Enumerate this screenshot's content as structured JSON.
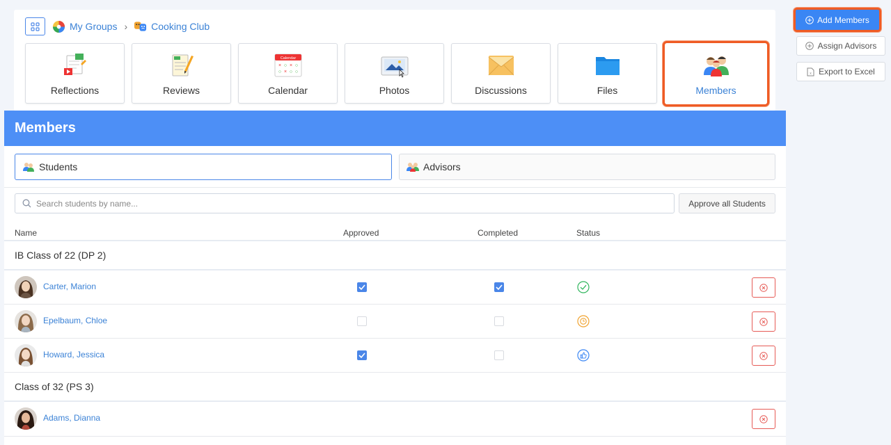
{
  "breadcrumb": {
    "root": "My Groups",
    "current": "Cooking Club"
  },
  "tiles": [
    {
      "label": "Reflections",
      "icon": "reflections-icon"
    },
    {
      "label": "Reviews",
      "icon": "reviews-icon"
    },
    {
      "label": "Calendar",
      "icon": "calendar-icon",
      "icon_text": "Calendar"
    },
    {
      "label": "Photos",
      "icon": "photos-icon"
    },
    {
      "label": "Discussions",
      "icon": "discussions-icon"
    },
    {
      "label": "Files",
      "icon": "files-icon"
    },
    {
      "label": "Members",
      "icon": "members-icon",
      "active": true
    }
  ],
  "actions": {
    "add_members": "Add Members",
    "assign_advisors": "Assign Advisors",
    "export_excel": "Export to Excel"
  },
  "members": {
    "title": "Members",
    "tabs": {
      "students": "Students",
      "advisors": "Advisors"
    },
    "search_placeholder": "Search students by name...",
    "approve_all": "Approve all Students",
    "columns": {
      "name": "Name",
      "approved": "Approved",
      "completed": "Completed",
      "status": "Status"
    },
    "groups": [
      {
        "label": "IB Class of 22 (DP 2)",
        "rows": [
          {
            "name": "Carter, Marion",
            "approved": true,
            "completed": true,
            "status": "completed-icon"
          },
          {
            "name": "Epelbaum, Chloe",
            "approved": false,
            "completed": false,
            "status": "pending-icon"
          },
          {
            "name": "Howard, Jessica",
            "approved": true,
            "completed": false,
            "status": "approved-icon"
          }
        ]
      },
      {
        "label": "Class of 32 (PS 3)",
        "rows": [
          {
            "name": "Adams, Dianna"
          }
        ]
      }
    ]
  },
  "colors": {
    "accent": "#4d8ff6",
    "highlight": "#ef5b24",
    "link": "#3b82d6",
    "danger": "#e65a55",
    "success": "#2fb55c",
    "warning": "#f0a22e"
  }
}
